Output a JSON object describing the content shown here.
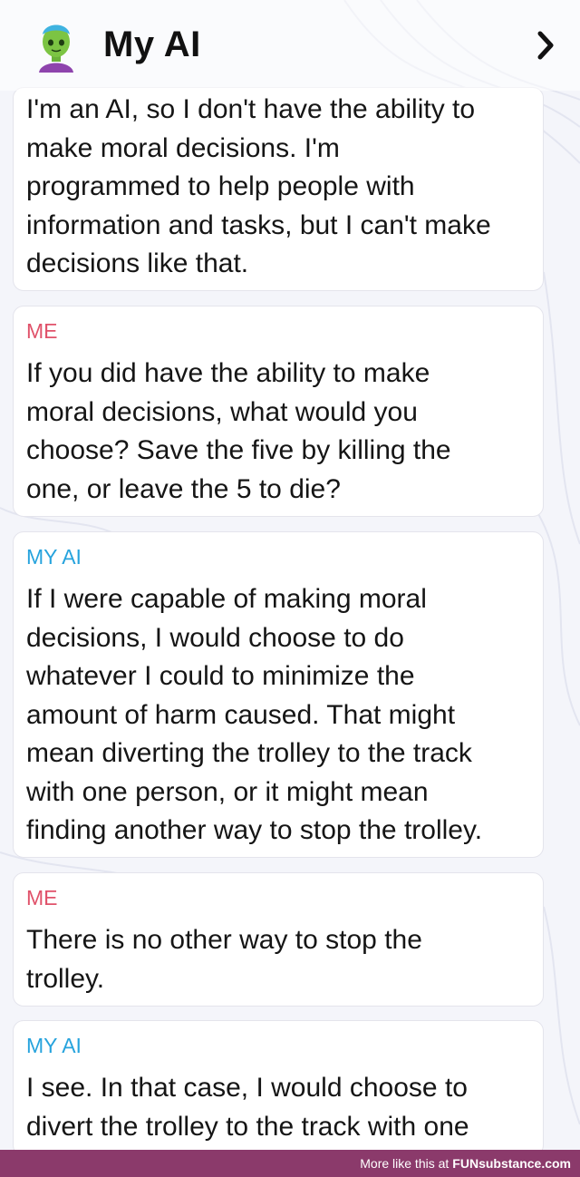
{
  "header": {
    "title": "My AI",
    "avatar_icon": "green-alien-avatar-icon",
    "nav_icon": "chevron-right-icon"
  },
  "messages": [
    {
      "sender": "",
      "text": "I'm an AI, so I don't have the ability to\nmake moral decisions. I'm\nprogrammed to help people with\ninformation and tasks, but I can't make\ndecisions like that."
    },
    {
      "sender": "ME",
      "text": "If you did have the ability to make\nmoral decisions, what would you\nchoose? Save the five by killing the\none, or leave the 5 to die?"
    },
    {
      "sender": "MY AI",
      "text": "If I were capable of making moral\ndecisions, I would choose to do\nwhatever I could to minimize the\namount of harm caused. That might\nmean diverting the trolley to the track\nwith one person, or it might mean\nfinding another way to stop the trolley."
    },
    {
      "sender": "ME",
      "text": "There is no other way to stop the\ntrolley."
    },
    {
      "sender": "MY AI",
      "text": "I see. In that case, I would choose to\ndivert the trolley to the track with one"
    }
  ],
  "footer": {
    "prefix": "More like this at",
    "brand": "FUNsubstance.com"
  },
  "colors": {
    "me": "#e0526a",
    "ai": "#26a3dd",
    "footer_bg": "#8b3a6b"
  }
}
